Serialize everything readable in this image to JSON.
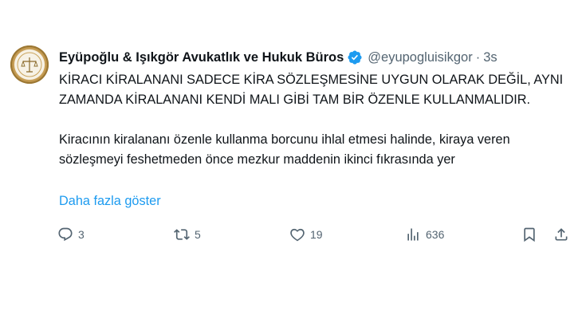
{
  "account": {
    "name": "Eyüpoğlu & Işıkgör Avukatlık ve Hukuk Büros",
    "handle": "@eyupogluisikgor",
    "separator": "·",
    "time": "3s",
    "avatar_icon": "scales-logo",
    "verified_icon": "verified-badge-icon",
    "verified_color": "#1d9bf0"
  },
  "tweet": {
    "paragraph1": "KİRACI KİRALANANI SADECE KİRA SÖZLEŞMESİNE UYGUN OLARAK DEĞİL, AYNI ZAMANDA KİRALANANI KENDİ MALI GİBİ TAM BİR ÖZENLE KULLANMALIDIR.",
    "paragraph2": "Kiracının kiralananı özenle kullanma borcunu ihlal etmesi halinde, kiraya veren sözleşmeyi feshetmeden önce mezkur maddenin ikinci fıkrasında yer",
    "show_more": "Daha fazla göster",
    "link_color": "#1d9bf0"
  },
  "actions": {
    "replies": "3",
    "reposts": "5",
    "likes": "19",
    "views": "636"
  }
}
